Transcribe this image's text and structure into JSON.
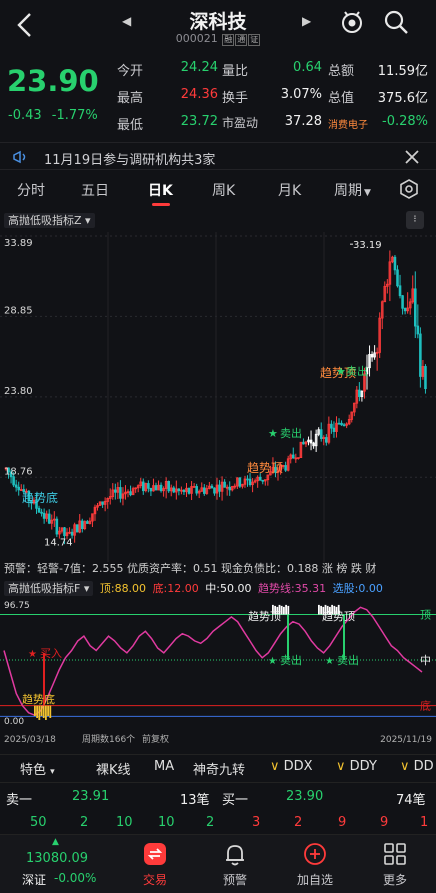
{
  "header": {
    "title": "深科技",
    "code": "000021",
    "tags": [
      "融",
      "通",
      "证"
    ]
  },
  "quote": {
    "price": "23.90",
    "change": "-0.43",
    "change_pct": "-1.77%",
    "rows": [
      {
        "l1": "今开",
        "v1": "24.24",
        "l2": "量比",
        "v2": "0.64",
        "l3": "总额",
        "v3": "11.59亿"
      },
      {
        "l1": "最高",
        "v1": "24.36",
        "l2": "换手",
        "v2": "3.07%",
        "l3": "总值",
        "v3": "375.6亿"
      },
      {
        "l1": "最低",
        "v1": "23.72",
        "l2": "市盈动",
        "v2": "37.28",
        "l3": "消费电子",
        "v3": "-0.28%"
      }
    ]
  },
  "notice": "11月19日参与调研机构共3家",
  "tabs": [
    "分时",
    "五日",
    "日K",
    "周K",
    "月K",
    "周期"
  ],
  "main_chart": {
    "indicator": "高抛低吸指标Z",
    "y_labels": [
      "33.89",
      "28.85",
      "23.80",
      "18.76"
    ],
    "high_label": "33.19",
    "low_label": "14.74",
    "annotations": [
      "趋势底",
      "趋势顶",
      "卖出",
      "卖出",
      "趋势底"
    ],
    "ticker": "预警：轻警-7值：2.555 优质资产率：0.51 现金负债比：0.188 涨 榜 跌 财"
  },
  "sub_chart": {
    "indicator": "高抛低吸指标F",
    "top_label": "顶:88.00",
    "bottom_label": "底:12.00",
    "mid_label": "中:50.00",
    "trend_label": "趋势线:35.31",
    "select_label": "选股:0.00",
    "y_top": "96.75",
    "y_bottom": "0.00",
    "right_top": "顶",
    "right_mid": "中",
    "right_bottom": "底",
    "marks": [
      "趋势顶",
      "趋势顶",
      "卖出",
      "卖出",
      "买入",
      "趋势底"
    ],
    "date_start": "2025/03/18",
    "date_end": "2025/11/19",
    "footer_info": "周期数166个",
    "footer_mode": "前复权"
  },
  "toolbar": [
    "特色",
    "裸K线",
    "MA",
    "神奇九转",
    "DDX",
    "DDY",
    "DD"
  ],
  "orderbook": {
    "sell_label": "卖一",
    "sell_price": "23.91",
    "sell_qty": "13笔",
    "buy_label": "买一",
    "buy_price": "23.90",
    "buy_qty": "74笔",
    "left_nums": [
      "50",
      "2",
      "10",
      "10",
      "2"
    ],
    "right_nums": [
      "3",
      "2",
      "9",
      "9",
      "1"
    ]
  },
  "bottom_nav": {
    "index_value": "13080.09",
    "index_name": "深证",
    "index_change": "-0.00%",
    "items": [
      "交易",
      "预警",
      "加自选",
      "更多"
    ]
  },
  "colors": {
    "up": "#ff3b3b",
    "down": "#28d06e",
    "bg": "#111216",
    "accent": "#f2c230"
  }
}
